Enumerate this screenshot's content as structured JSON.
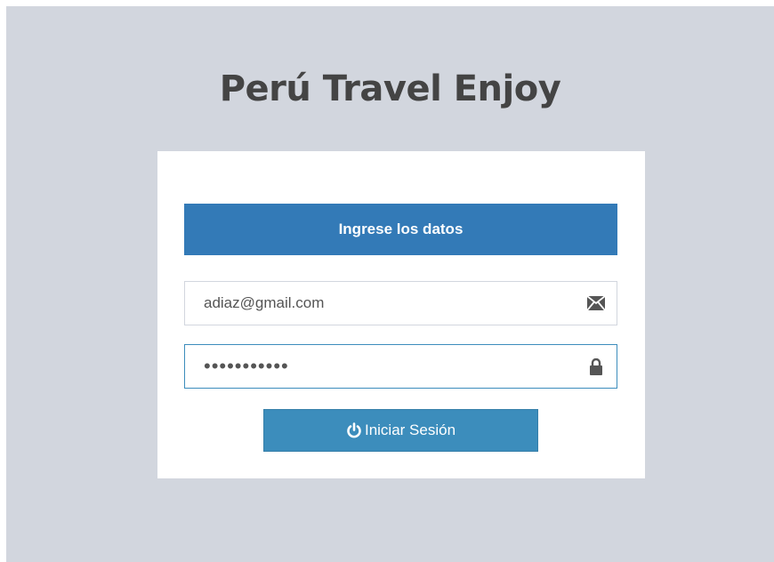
{
  "app": {
    "title": "Perú Travel Enjoy"
  },
  "login_box": {
    "header": "Ingrese los datos",
    "email": {
      "value": "adiaz@gmail.com",
      "icon": "envelope-icon"
    },
    "password": {
      "value": "adminadmin1",
      "icon": "lock-icon"
    },
    "submit": {
      "label": "Iniciar Sesión",
      "icon": "power-icon"
    }
  },
  "colors": {
    "background": "#d2d6de",
    "header_bar": "#337ab7",
    "button": "#3c8dbc",
    "title_text": "#444444"
  }
}
